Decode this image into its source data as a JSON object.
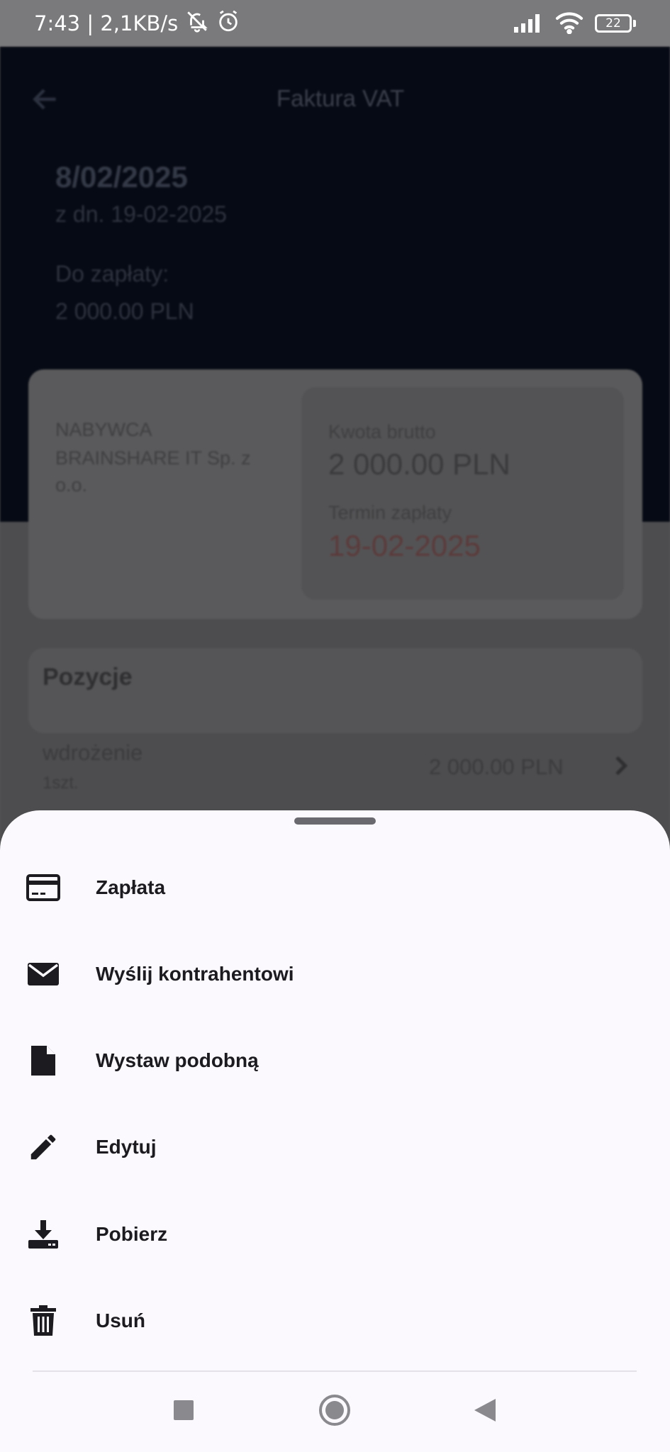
{
  "status_bar": {
    "time_speed": "7:43 | 2,1KB/s",
    "battery": "22"
  },
  "background": {
    "header_title": "Faktura VAT",
    "invoice_number": "8/02/2025",
    "invoice_date": "z dn. 19-02-2025",
    "due_label": "Do zapłaty:",
    "due_amount": "2 000.00  PLN",
    "buyer_label": "NABYWCA",
    "buyer_name_1": "BRAINSHARE IT Sp. z",
    "buyer_name_2": "o.o.",
    "gross_label": "Kwota brutto",
    "gross_value": "2 000.00  PLN",
    "deadline_label": "Termin zapłaty",
    "deadline_value": "19-02-2025",
    "positions_title": "Pozycje",
    "position_name": "wdrożenie",
    "position_qty": "1szt.",
    "position_amount": "2 000.00  PLN",
    "colors": {
      "deadline": "#b3261e"
    }
  },
  "sheet": {
    "items": [
      {
        "label": "Zapłata",
        "icon": "credit-card-icon"
      },
      {
        "label": "Wyślij kontrahentowi",
        "icon": "email-icon"
      },
      {
        "label": "Wystaw podobną",
        "icon": "document-icon"
      },
      {
        "label": "Edytuj",
        "icon": "pencil-icon"
      },
      {
        "label": "Pobierz",
        "icon": "download-icon"
      },
      {
        "label": "Usuń",
        "icon": "trash-icon"
      }
    ]
  }
}
